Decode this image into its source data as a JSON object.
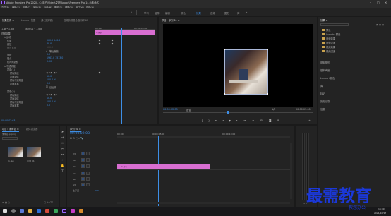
{
  "app": {
    "title": "Adobe Premiere Pro 2020 - C:\\用户\\Video\\文档\\Adobe\\Premiere Pro\\14.0\\未命名"
  },
  "menu": [
    "文件(F)",
    "编辑(E)",
    "剪辑(C)",
    "序列(S)",
    "标记(M)",
    "图形(G)",
    "视图(V)",
    "窗口(W)",
    "帮助(H)"
  ],
  "workspaces": [
    "学习",
    "组件",
    "编辑",
    "颜色",
    "效果",
    "音频",
    "图形",
    "库"
  ],
  "active_workspace": "效果",
  "effect_controls": {
    "tabs": [
      "效果控件 ≡",
      "Lumetri 范围",
      "源:(无剪辑)",
      "音频剪辑混合器:序列01"
    ],
    "source_label": "主要 * 1.jpg",
    "sequence_label": "序列 01 * 1.jpg",
    "timecodes": [
      "00:00",
      "00:00:05:00"
    ],
    "clip_name": "1.jpg",
    "section_video": "视频效果",
    "rows": [
      {
        "label": "fx 运动",
        "value": ""
      },
      {
        "label": "位置",
        "value": "960.0   540.0"
      },
      {
        "label": "缩放",
        "value": "80.0"
      },
      {
        "label": "缩放宽度",
        "value": "100.0"
      },
      {
        "label": "等比缩放",
        "value": "✓"
      },
      {
        "label": "旋转",
        "value": "0.0"
      },
      {
        "label": "锚点",
        "value": "1963.0   1513.0"
      },
      {
        "label": "防闪烁滤镜",
        "value": "0.00"
      },
      {
        "label": "fx 不透明度",
        "value": ""
      },
      {
        "label": "蒙版(1)",
        "value": ""
      },
      {
        "label": "蒙版路径",
        "value": ""
      },
      {
        "label": "蒙版羽化",
        "value": "10.0"
      },
      {
        "label": "蒙版不透明度",
        "value": "100.0 %"
      },
      {
        "label": "蒙版扩展",
        "value": "0.0"
      },
      {
        "label": "已反转",
        "value": ""
      },
      {
        "label": "蒙版(2)",
        "value": ""
      },
      {
        "label": "蒙版路径",
        "value": ""
      },
      {
        "label": "蒙版羽化",
        "value": "10.0"
      },
      {
        "label": "蒙版不透明度",
        "value": "100.0 %"
      },
      {
        "label": "蒙版扩展",
        "value": "0.0"
      }
    ],
    "current_time": "00:00:02:03"
  },
  "program_monitor": {
    "tab": "节目：序列 01 ≡",
    "timecode_left": "00:00:02:03",
    "fit": "适合",
    "quality": "1/2",
    "timecode_right": "00:00:05:00"
  },
  "project": {
    "tabs": [
      "项目：未命名 ≡",
      "媒体浏览器"
    ],
    "name": "未命名.prproj",
    "items": [
      "1.jpg",
      "序列 01"
    ]
  },
  "timeline": {
    "tab": "序列 01 ≡",
    "timecode": "00:00:02:03",
    "ruler": [
      "00:00",
      "00:00:05:00",
      "00:00:10:00"
    ],
    "video_tracks": [
      "V3",
      "V2",
      "V1"
    ],
    "audio_tracks": [
      "A1",
      "A2",
      "A3"
    ],
    "mix_label": "主声道",
    "mix_value": "0.0",
    "clip_label": "1.jpg"
  },
  "effects_panel": {
    "title": "效果 ≡",
    "items": [
      "预设",
      "Lumetri 预设",
      "音频效果",
      "音频过渡",
      "视频效果",
      "视频过渡"
    ],
    "groups": [
      "基本图形",
      "基本声音",
      "Lumetri 颜色",
      "库",
      "标记",
      "历史记录",
      "信息"
    ]
  },
  "taskbar": {
    "time": "16:49",
    "date": "2021/10/17"
  },
  "watermark": {
    "main": "最需教育",
    "sub": "教您办公"
  }
}
